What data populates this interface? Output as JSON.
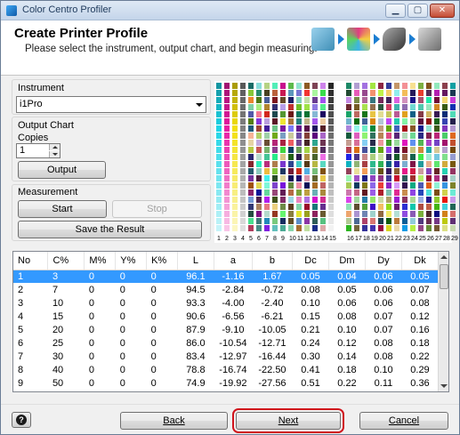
{
  "window": {
    "title": "Color Centro Profiler"
  },
  "header": {
    "title": "Create Printer Profile",
    "subtitle": "Please select the instrument, output chart, and begin measuring."
  },
  "steps": [
    {
      "icon": "printer-setup-icon",
      "color": "#3f8fb7"
    },
    {
      "icon": "color-chart-icon",
      "color": "#b03a6a"
    },
    {
      "icon": "measure-instrument-icon",
      "color": "#444444"
    },
    {
      "icon": "profile-save-icon",
      "color": "#6d6d6d"
    }
  ],
  "instrument": {
    "label": "Instrument",
    "value": "i1Pro"
  },
  "output_chart": {
    "label": "Output Chart",
    "copies_label": "Copies",
    "copies_value": "1",
    "output_button": "Output"
  },
  "measurement": {
    "label": "Measurement",
    "start_button": "Start",
    "stop_button": "Stop",
    "save_button": "Save the Result"
  },
  "chart_columns_left": [
    "1",
    "2",
    "3",
    "4",
    "5",
    "6",
    "7",
    "8",
    "9",
    "10",
    "11",
    "12",
    "13",
    "14",
    "15"
  ],
  "chart_columns_right": [
    "16",
    "17",
    "18",
    "19",
    "20",
    "21",
    "22",
    "23",
    "24",
    "25",
    "26",
    "27",
    "28",
    "29"
  ],
  "table": {
    "headers": [
      "No",
      "C%",
      "M%",
      "Y%",
      "K%",
      "L",
      "a",
      "b",
      "Dc",
      "Dm",
      "Dy",
      "Dk"
    ],
    "rows": [
      [
        "1",
        "3",
        "0",
        "0",
        "0",
        "96.1",
        "-1.16",
        "1.67",
        "0.05",
        "0.04",
        "0.06",
        "0.05"
      ],
      [
        "2",
        "7",
        "0",
        "0",
        "0",
        "94.5",
        "-2.84",
        "-0.72",
        "0.08",
        "0.05",
        "0.06",
        "0.07"
      ],
      [
        "3",
        "10",
        "0",
        "0",
        "0",
        "93.3",
        "-4.00",
        "-2.40",
        "0.10",
        "0.06",
        "0.06",
        "0.08"
      ],
      [
        "4",
        "15",
        "0",
        "0",
        "0",
        "90.6",
        "-6.56",
        "-6.21",
        "0.15",
        "0.08",
        "0.07",
        "0.12"
      ],
      [
        "5",
        "20",
        "0",
        "0",
        "0",
        "87.9",
        "-9.10",
        "-10.05",
        "0.21",
        "0.10",
        "0.07",
        "0.16"
      ],
      [
        "6",
        "25",
        "0",
        "0",
        "0",
        "86.0",
        "-10.54",
        "-12.71",
        "0.24",
        "0.12",
        "0.08",
        "0.18"
      ],
      [
        "7",
        "30",
        "0",
        "0",
        "0",
        "83.4",
        "-12.97",
        "-16.44",
        "0.30",
        "0.14",
        "0.08",
        "0.22"
      ],
      [
        "8",
        "40",
        "0",
        "0",
        "0",
        "78.8",
        "-16.74",
        "-22.50",
        "0.41",
        "0.18",
        "0.10",
        "0.29"
      ],
      [
        "9",
        "50",
        "0",
        "0",
        "0",
        "74.9",
        "-19.92",
        "-27.56",
        "0.51",
        "0.22",
        "0.11",
        "0.36"
      ]
    ],
    "selected_row": 0
  },
  "footer": {
    "back_button": "Back",
    "next_button": "Next",
    "cancel_button": "Cancel"
  },
  "colors": {
    "selection": "#3399ff",
    "highlight_outline": "#d0141c",
    "step_arrow": "#1b7dd1"
  }
}
